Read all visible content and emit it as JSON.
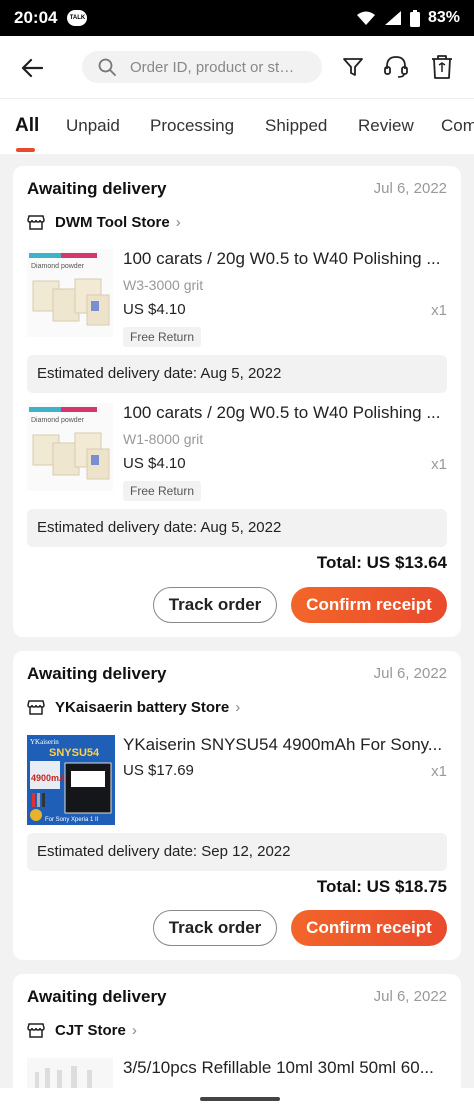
{
  "status_bar": {
    "time": "20:04",
    "talk_label": "TALK",
    "battery": "83%"
  },
  "header": {
    "search_placeholder": "Order ID, product or stor..."
  },
  "tabs": [
    {
      "label": "All"
    },
    {
      "label": "Unpaid"
    },
    {
      "label": "Processing"
    },
    {
      "label": "Shipped"
    },
    {
      "label": "Review"
    },
    {
      "label": "Com"
    }
  ],
  "orders": [
    {
      "status": "Awaiting delivery",
      "date": "Jul 6, 2022",
      "store": "DWM Tool Store",
      "items": [
        {
          "title": "100 carats / 20g W0.5 to W40 Polishing ...",
          "variant": "W3-3000 grit",
          "price": "US $4.10",
          "qty": "x1",
          "badge": "Free Return",
          "estimated": "Estimated delivery date: Aug 5, 2022",
          "image_label": "Diamond powder"
        },
        {
          "title": "100 carats / 20g W0.5 to W40 Polishing ...",
          "variant": "W1-8000 grit",
          "price": "US $4.10",
          "qty": "x1",
          "badge": "Free Return",
          "estimated": "Estimated delivery date: Aug 5, 2022",
          "image_label": "Diamond powder"
        }
      ],
      "total": "Total: US $13.64",
      "track_label": "Track order",
      "confirm_label": "Confirm receipt"
    },
    {
      "status": "Awaiting delivery",
      "date": "Jul 6, 2022",
      "store": "YKaisaerin battery Store",
      "items": [
        {
          "title": "YKaiserin SNYSU54  4900mAh  For Sony...",
          "price": "US $17.69",
          "qty": "x1",
          "estimated": "Estimated delivery date: Sep 12, 2022",
          "image_label": "SNYSU54",
          "image_sublabel": "4900mAh",
          "image_brand": "YKaiserin",
          "image_caption": "For Sony Xperia 1 II"
        }
      ],
      "total": "Total: US $18.75",
      "track_label": "Track order",
      "confirm_label": "Confirm receipt"
    },
    {
      "status": "Awaiting delivery",
      "date": "Jul 6, 2022",
      "store": "CJT Store",
      "items": [
        {
          "title": "3/5/10pcs Refillable 10ml 30ml 50ml 60..."
        }
      ]
    }
  ],
  "colors": {
    "accent": "#e94a2c",
    "accent_light": "#f2662a",
    "background": "#f2f2f2"
  }
}
